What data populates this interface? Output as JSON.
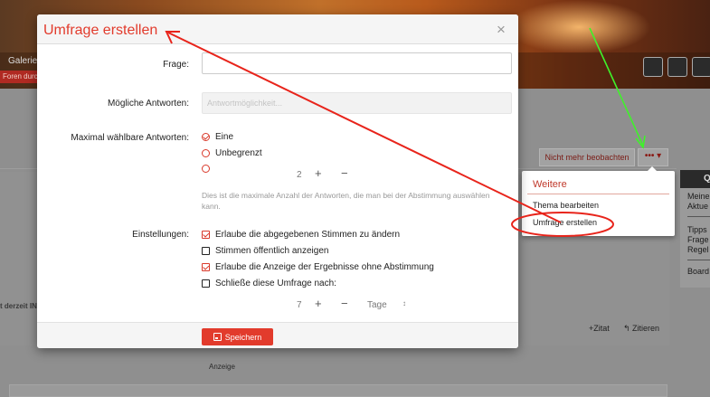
{
  "background": {
    "nav_item": "Galerie",
    "nav_sub": "Foren durc",
    "watch_button": "Nicht mehr beobachten",
    "more_button": "••• ▾",
    "left_text": "t derzeit IN",
    "side_header": "Q",
    "side_lines": [
      "Meine",
      "Aktue",
      "Tipps",
      "Frage",
      "Regel",
      "Board"
    ],
    "post_actions": {
      "quote": "+Zitat",
      "cite": "↰ Zitieren"
    },
    "ad_label": "Anzeige"
  },
  "dropdown": {
    "title": "Weitere",
    "items": [
      "Thema bearbeiten",
      "Umfrage erstellen"
    ]
  },
  "modal": {
    "title": "Umfrage erstellen",
    "close": "×",
    "question_label": "Frage:",
    "question_value": "",
    "answers_label": "Mögliche Antworten:",
    "answers_placeholder": "Antwortmöglichkeit...",
    "max_label": "Maximal wählbare Antworten:",
    "max_options": [
      "Eine",
      "Unbegrenzt"
    ],
    "max_count": "2",
    "plus": "+",
    "minus": "−",
    "help_text": "Dies ist die maximale Anzahl der Antworten, die man bei der Abstimmung auswählen kann.",
    "settings_label": "Einstellungen:",
    "settings": [
      {
        "label": "Erlaube die abgegebenen Stimmen zu ändern",
        "checked": true
      },
      {
        "label": "Stimmen öffentlich anzeigen",
        "checked": false
      },
      {
        "label": "Erlaube die Anzeige der Ergebnisse ohne Abstimmung",
        "checked": true
      },
      {
        "label": "Schließe diese Umfrage nach:",
        "checked": false
      }
    ],
    "close_after_value": "7",
    "close_after_unit": "Tage",
    "unit_caret": "↕",
    "save_label": "Speichern"
  },
  "colors": {
    "accent": "#e23b2c",
    "annotation_red": "#e8241b",
    "annotation_green": "#3ff22a"
  }
}
